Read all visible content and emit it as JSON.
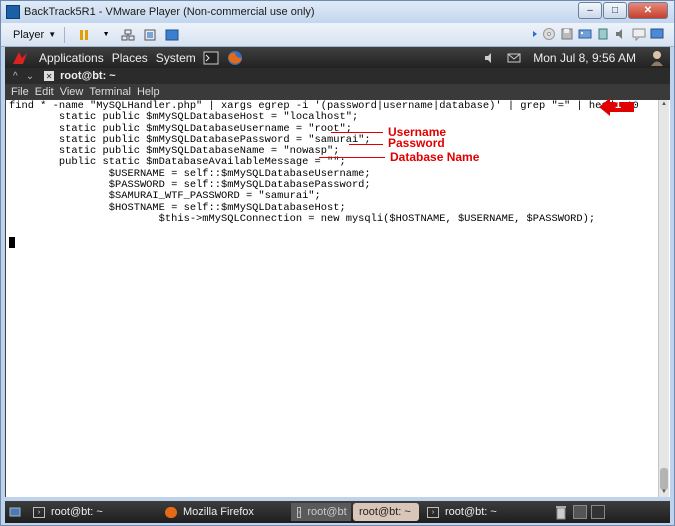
{
  "vmware": {
    "title": "BackTrack5R1 - VMware Player (Non-commercial use only)",
    "player_label": "Player",
    "win_min": "–",
    "win_max": "□",
    "win_close": "✕"
  },
  "gnome_panel": {
    "menus": [
      "Applications",
      "Places",
      "System"
    ],
    "clock": "Mon Jul  8,  9:56 AM"
  },
  "terminal": {
    "title": "root@bt: ~",
    "menu": [
      "File",
      "Edit",
      "View",
      "Terminal",
      "Help"
    ],
    "lines": [
      "find * -name \"MySQLHandler.php\" | xargs egrep -i '(password|username|database)' | grep \"=\" | head -10",
      "        static public $mMySQLDatabaseHost = \"localhost\";",
      "        static public $mMySQLDatabaseUsername = \"root\";",
      "        static public $mMySQLDatabasePassword = \"samurai\";",
      "        static public $mMySQLDatabaseName = \"nowasp\";",
      "        public static $mDatabaseAvailableMessage = \"\";",
      "                $USERNAME = self::$mMySQLDatabaseUsername;",
      "                $PASSWORD = self::$mMySQLDatabasePassword;",
      "                $SAMURAI_WTF_PASSWORD = \"samurai\";",
      "                $HOSTNAME = self::$mMySQLDatabaseHost;",
      "                        $this->mMySQLConnection = new mysqli($HOSTNAME, $USERNAME, $PASSWORD);"
    ]
  },
  "annotations": {
    "username": "Username",
    "password": "Password",
    "database": "Database Name",
    "step_number": "1"
  },
  "taskbar": {
    "tasks": [
      "root@bt: ~",
      "Mozilla Firefox",
      "root@bt",
      "root@bt: ~",
      "root@bt: ~"
    ]
  },
  "colors": {
    "annotation": "#e10000",
    "panel": "#2b2b2b",
    "terminal_bg": "#ffffff"
  }
}
